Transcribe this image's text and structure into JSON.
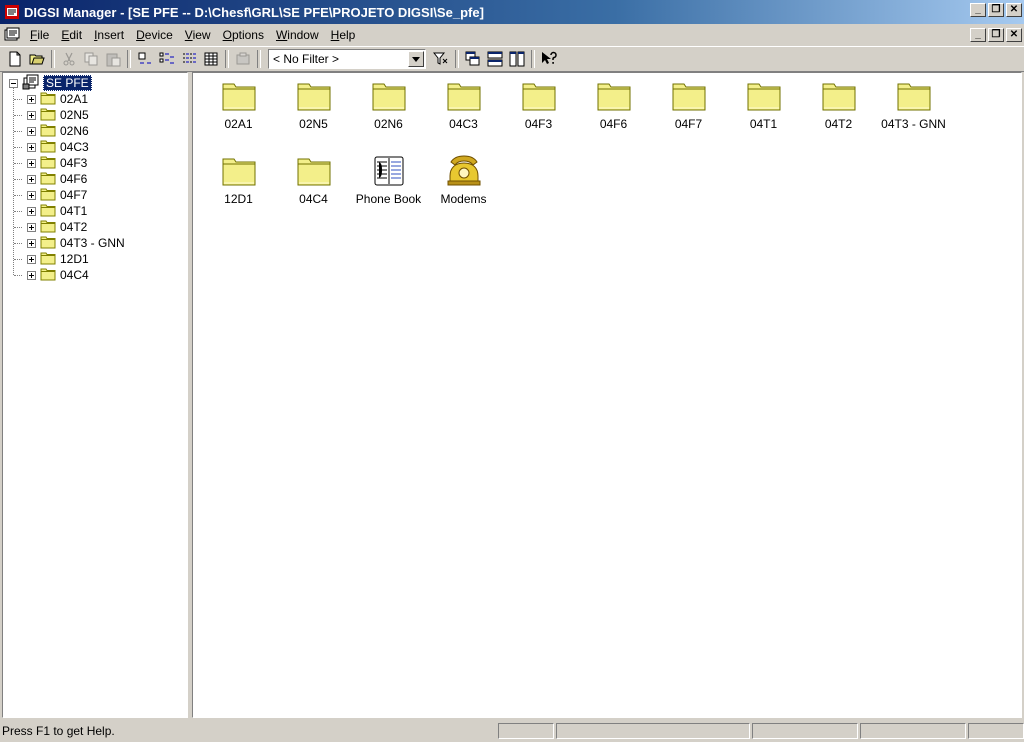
{
  "window": {
    "title": "DIGSI Manager - [SE PFE -- D:\\Chesf\\GRL\\SE PFE\\PROJETO DIGSI\\Se_pfe]",
    "minimize": "_",
    "restore": "❐",
    "close": "✕"
  },
  "menu": [
    "File",
    "Edit",
    "Insert",
    "Device",
    "View",
    "Options",
    "Window",
    "Help"
  ],
  "toolbar": {
    "filter_value": "< No Filter >"
  },
  "tree": {
    "root_label": "SE PFE",
    "items": [
      "02A1",
      "02N5",
      "02N6",
      "04C3",
      "04F3",
      "04F6",
      "04F7",
      "04T1",
      "04T2",
      "04T3 - GNN",
      "12D1",
      "04C4"
    ]
  },
  "list": {
    "items": [
      {
        "label": "02A1",
        "icon": "folder-icon"
      },
      {
        "label": "02N5",
        "icon": "folder-icon"
      },
      {
        "label": "02N6",
        "icon": "folder-icon"
      },
      {
        "label": "04C3",
        "icon": "folder-icon"
      },
      {
        "label": "04F3",
        "icon": "folder-icon"
      },
      {
        "label": "04F6",
        "icon": "folder-icon"
      },
      {
        "label": "04F7",
        "icon": "folder-icon"
      },
      {
        "label": "04T1",
        "icon": "folder-icon"
      },
      {
        "label": "04T2",
        "icon": "folder-icon"
      },
      {
        "label": "04T3 - GNN",
        "icon": "folder-icon"
      },
      {
        "label": "12D1",
        "icon": "folder-icon"
      },
      {
        "label": "04C4",
        "icon": "folder-icon"
      },
      {
        "label": "Phone Book",
        "icon": "phone-book-icon"
      },
      {
        "label": "Modems",
        "icon": "modem-phone-icon"
      }
    ]
  },
  "status": {
    "text": "Press F1 to get Help."
  },
  "colors": {
    "title_active": "#0a246a",
    "face": "#d4d0c8",
    "folder": "#f3ef8a"
  }
}
